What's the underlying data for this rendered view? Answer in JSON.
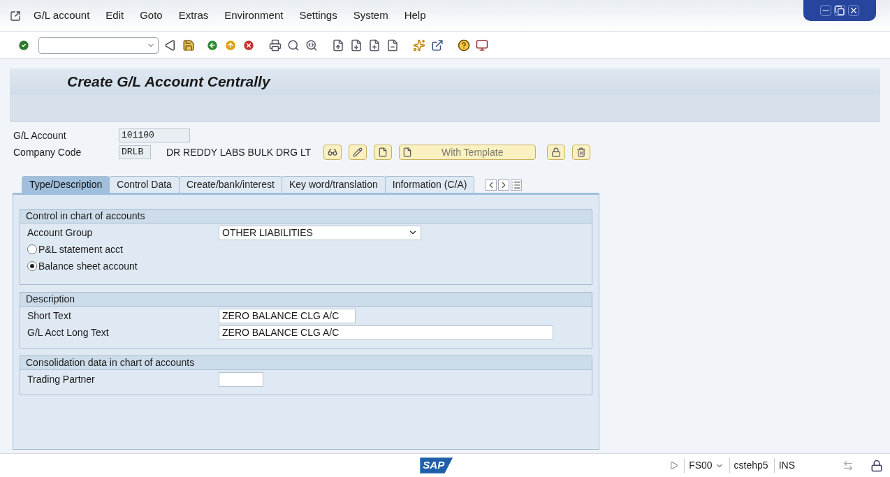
{
  "menu": [
    "G/L account",
    "Edit",
    "Goto",
    "Extras",
    "Environment",
    "Settings",
    "System",
    "Help"
  ],
  "title": "Create G/L Account Centrally",
  "header_fields": [
    {
      "label": "G/L Account",
      "value": "101100"
    },
    {
      "label": "Company Code",
      "value": "DRLB",
      "description": "DR REDDY LABS BULK DRG LT"
    }
  ],
  "template_button": "With Template",
  "tabs": [
    {
      "label": "Type/Description",
      "selected": true
    },
    {
      "label": "Control Data",
      "selected": false
    },
    {
      "label": "Create/bank/interest",
      "selected": false
    },
    {
      "label": "Key word/translation",
      "selected": false
    },
    {
      "label": "Information (C/A)",
      "selected": false
    }
  ],
  "sections": [
    {
      "title": "Control in chart of accounts",
      "rows": [
        {
          "kind": "dropdown",
          "label": "Account Group",
          "value": "OTHER LIABILITIES"
        },
        {
          "kind": "radio",
          "label": "P&L statement acct",
          "selected": false
        },
        {
          "kind": "radio",
          "label": "Balance sheet account",
          "selected": true
        }
      ]
    },
    {
      "title": "Description",
      "rows": [
        {
          "kind": "short",
          "label": "Short Text",
          "value": "ZERO BALANCE CLG A/C"
        },
        {
          "kind": "long",
          "label": "G/L Acct Long Text",
          "value": "ZERO BALANCE CLG A/C"
        }
      ]
    },
    {
      "title": "Consolidation data in chart of accounts",
      "rows": [
        {
          "kind": "tiny",
          "label": "Trading Partner"
        }
      ]
    }
  ],
  "logo": "SAP",
  "status": {
    "transaction": "FS00",
    "system": "cstehp5",
    "mode": "INS"
  }
}
